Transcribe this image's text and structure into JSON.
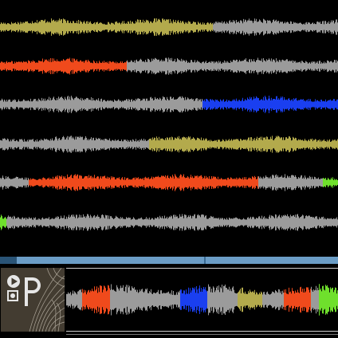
{
  "colors": {
    "background": "#000000",
    "neutral_wave": "#9b9b9b",
    "olive": "#b3aa4c",
    "orange": "#f04a1c",
    "blue": "#1a3ff0",
    "green": "#6fe02c",
    "scroll_track": "#2a5476",
    "scroll_thumb": "#6b9dc6",
    "logo_bg": "#433c31"
  },
  "tracks": [
    {
      "segments": [
        {
          "from": 0.0,
          "to": 0.63,
          "color": "olive"
        },
        {
          "from": 0.63,
          "to": 1.0,
          "color": "neutral_wave"
        }
      ]
    },
    {
      "segments": [
        {
          "from": 0.0,
          "to": 0.375,
          "color": "orange"
        },
        {
          "from": 0.375,
          "to": 1.0,
          "color": "neutral_wave"
        }
      ]
    },
    {
      "segments": [
        {
          "from": 0.0,
          "to": 0.6,
          "color": "neutral_wave"
        },
        {
          "from": 0.6,
          "to": 1.0,
          "color": "blue"
        }
      ]
    },
    {
      "segments": [
        {
          "from": 0.0,
          "to": 0.44,
          "color": "neutral_wave"
        },
        {
          "from": 0.44,
          "to": 1.0,
          "color": "olive"
        }
      ]
    },
    {
      "segments": [
        {
          "from": 0.0,
          "to": 0.085,
          "color": "neutral_wave"
        },
        {
          "from": 0.085,
          "to": 0.765,
          "color": "orange"
        },
        {
          "from": 0.765,
          "to": 0.955,
          "color": "neutral_wave"
        },
        {
          "from": 0.955,
          "to": 1.0,
          "color": "green"
        }
      ]
    },
    {
      "segments": [
        {
          "from": 0.0,
          "to": 0.02,
          "color": "green"
        },
        {
          "from": 0.02,
          "to": 1.0,
          "color": "neutral_wave"
        }
      ]
    }
  ],
  "scroll_position": 0.05,
  "overview": {
    "segments": [
      {
        "from": 0.0,
        "to": 0.06,
        "color": "neutral_wave"
      },
      {
        "from": 0.06,
        "to": 0.16,
        "color": "orange"
      },
      {
        "from": 0.16,
        "to": 0.42,
        "color": "neutral_wave"
      },
      {
        "from": 0.42,
        "to": 0.52,
        "color": "blue"
      },
      {
        "from": 0.52,
        "to": 0.63,
        "color": "neutral_wave"
      },
      {
        "from": 0.63,
        "to": 0.72,
        "color": "olive"
      },
      {
        "from": 0.72,
        "to": 0.8,
        "color": "neutral_wave"
      },
      {
        "from": 0.8,
        "to": 0.9,
        "color": "orange"
      },
      {
        "from": 0.9,
        "to": 0.93,
        "color": "neutral_wave"
      },
      {
        "from": 0.93,
        "to": 1.0,
        "color": "green"
      }
    ]
  },
  "icons": {
    "logo": "app-logo-icon",
    "play": "play-icon",
    "record": "record-icon"
  }
}
